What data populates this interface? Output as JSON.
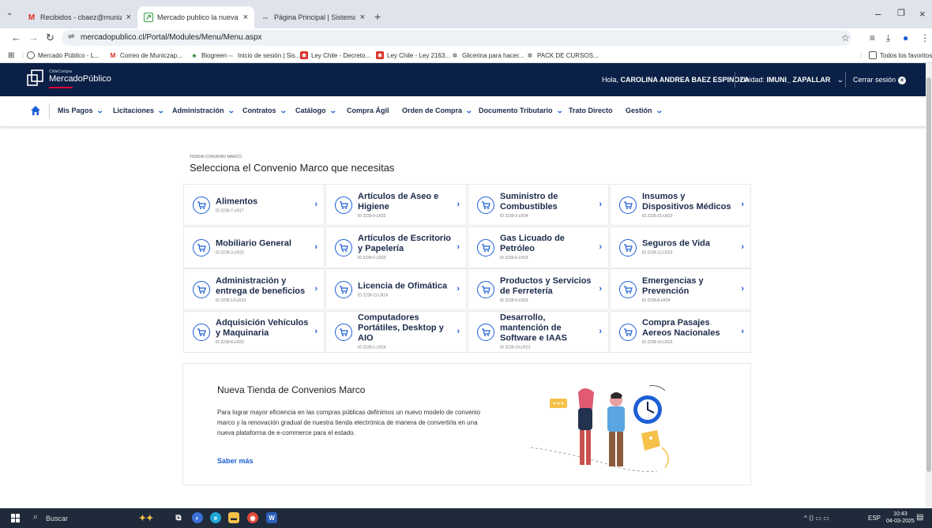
{
  "browser": {
    "tabs": [
      {
        "label": "Recibidos - cbaez@munizapallar",
        "favicon": "gmail-icon"
      },
      {
        "label": "Mercado publico la nueva plata",
        "favicon": "mercadopublico-icon"
      },
      {
        "label": "Página Principal | Sistema Gesti",
        "favicon": "sistema-icon"
      }
    ],
    "url": "mercadopublico.cl/Portal/Modules/Menu/Menu.aspx",
    "bookmarks": [
      "Mercado Público - L...",
      "Correo de Municzap...",
      "Biogreen",
      "Inicio de sesión | Sis...",
      "Ley Chile - Decreto...",
      "Ley Chile - Ley 2163...",
      "Glicerina para hacer...",
      "PACK DE CURSOS..."
    ],
    "all_bookmarks": "Todos los favoritos"
  },
  "header": {
    "logo_small": "ChileCompra",
    "logo_name": "MercadoPúblico",
    "greeting_prefix": "Hola, ",
    "user_name": "CAROLINA ANDREA BAEZ ESPINOZA",
    "unit_prefix": "Unidad: ",
    "unit_name": "IMUNI_ ZAPALLAR",
    "logout": "Cerrar sesión"
  },
  "nav": {
    "items": [
      {
        "label": "Mis Pagos",
        "dropdown": true
      },
      {
        "label": "Licitaciones",
        "dropdown": true
      },
      {
        "label": "Administración",
        "dropdown": true
      },
      {
        "label": "Contratos",
        "dropdown": true
      },
      {
        "label": "Catálogo",
        "dropdown": true
      },
      {
        "label": "Compra Ágil",
        "dropdown": false
      },
      {
        "label": "Orden de Compra",
        "dropdown": true
      },
      {
        "label": "Documento Tributario",
        "dropdown": true
      },
      {
        "label": "Trato Directo",
        "dropdown": false
      },
      {
        "label": "Gestión",
        "dropdown": true
      }
    ]
  },
  "store": {
    "section_label": "TIENDA CONVENIO MARCO",
    "title": "Selecciona el Convenio Marco que necesitas",
    "cards": [
      {
        "name": "Alimentos",
        "id": "ID 2239-7-LR17"
      },
      {
        "name": "Artículos de Aseo e Higiene",
        "id": "ID 2239-9-LR22"
      },
      {
        "name": "Suministro de Combustibles",
        "id": "ID 2239-3-LR24"
      },
      {
        "name": "Insumos y Dispositivos Médicos",
        "id": "ID 2239-21-LR23"
      },
      {
        "name": "Mobiliario General",
        "id": "ID 2239-3-LR23"
      },
      {
        "name": "Artículos de Escritorio y Papelería",
        "id": "ID 2239-2-LR23"
      },
      {
        "name": "Gas Licuado de Petróleo",
        "id": "ID 2239-6-LR23"
      },
      {
        "name": "Seguros de Vida",
        "id": "ID 2239-12-LR23"
      },
      {
        "name": "Administración y entrega de beneficios",
        "id": "ID 2239-13-LR23"
      },
      {
        "name": "Licencia de Ofimática",
        "id": "ID 2239-11-LR24"
      },
      {
        "name": "Productos y Servicios de Ferretería",
        "id": "ID 2239-9-LR23"
      },
      {
        "name": "Emergencias y Prevención",
        "id": "ID 2239-8-LR24"
      },
      {
        "name": "Adquisición Vehículos y Maquinaria",
        "id": "ID 2239-8-LR23"
      },
      {
        "name": "Computadores Portátiles, Desktop y AIO",
        "id": "ID 2239-1-LR24"
      },
      {
        "name": "Desarrollo, mantención de Software e IAAS",
        "id": "ID 2239-19-LR23"
      },
      {
        "name": "Compra Pasajes Aereos Nacionales",
        "id": "ID 2239-16-LR23"
      }
    ]
  },
  "promo": {
    "title": "Nueva Tienda de Convenios Marco",
    "body": "Para lograr mayor eficiencia en las compras públicas definimos un nuevo modelo de convenio marco y la renovación gradual de nuestra tienda electrónica de manera de convertirla en una nueva plataforma de e-commerce para el estado.",
    "link": "Saber más"
  },
  "taskbar": {
    "search": "Buscar",
    "lang": "ESP",
    "time": "10:43",
    "date": "04-03-2025"
  },
  "colors": {
    "header_bg": "#0b2046",
    "accent": "#1d5fd6"
  }
}
